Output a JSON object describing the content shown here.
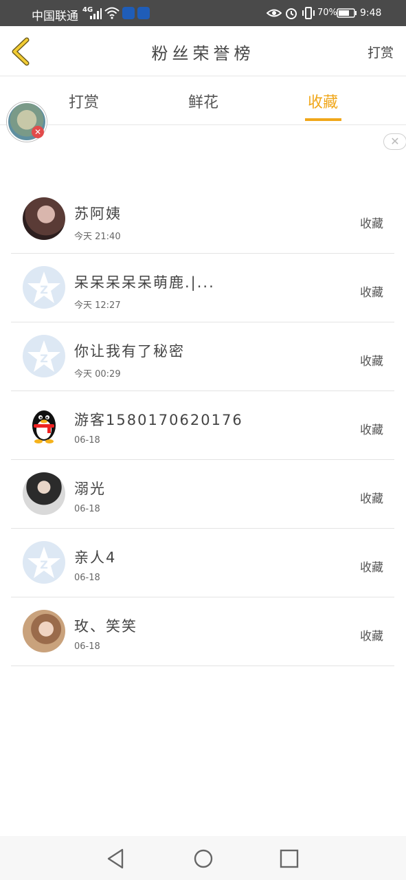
{
  "status_bar": {
    "carrier": "中国联通",
    "network": "4G",
    "battery_percent": "70%",
    "time": "9:48",
    "icons": [
      "signal-icon",
      "wifi-icon",
      "app-notification-icon",
      "app-notification-icon",
      "eye-icon",
      "alarm-icon",
      "vibrate-icon",
      "battery-icon"
    ]
  },
  "header": {
    "title": "粉丝荣誉榜",
    "right_button": "打赏",
    "back_icon": "chevron-left-icon",
    "accent_color": "#f0a71a"
  },
  "tabs": [
    {
      "label": "打赏",
      "active": false
    },
    {
      "label": "鲜花",
      "active": false
    },
    {
      "label": "收藏",
      "active": true
    }
  ],
  "list": [
    {
      "name": "苏阿姨",
      "time": "今天 21:40",
      "action": "收藏",
      "avatar": "photo"
    },
    {
      "name": "呆呆呆呆呆萌鹿.|...",
      "time": "今天 12:27",
      "action": "收藏",
      "avatar": "default-star-icon"
    },
    {
      "name": "你让我有了秘密",
      "time": "今天 00:29",
      "action": "收藏",
      "avatar": "default-star-icon"
    },
    {
      "name": "游客15801706201​76",
      "time": "06-18",
      "action": "收藏",
      "avatar": "penguin-icon"
    },
    {
      "name": "溺光",
      "time": "06-18",
      "action": "收藏",
      "avatar": "photo"
    },
    {
      "name": "亲人4",
      "time": "06-18",
      "action": "收藏",
      "avatar": "default-star-icon"
    },
    {
      "name": "玫、笑笑",
      "time": "06-18",
      "action": "收藏",
      "avatar": "photo"
    }
  ],
  "nav": {
    "icons": [
      "nav-back-icon",
      "nav-home-icon",
      "nav-recent-icon"
    ]
  }
}
